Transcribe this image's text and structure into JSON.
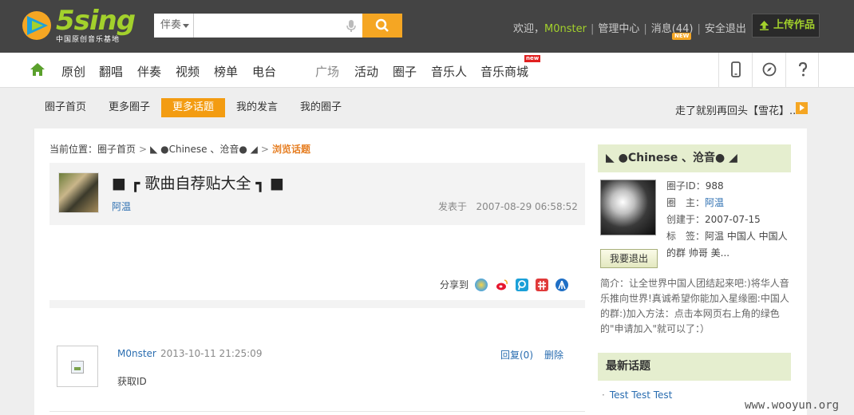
{
  "logo": {
    "text": "5sing",
    "subtitle": "中国原创音乐基地"
  },
  "search": {
    "type_label": "伴奏",
    "placeholder": ""
  },
  "user_bar": {
    "welcome": "欢迎，",
    "username": "M0nster",
    "admin": "管理中心",
    "messages": "消息(44)",
    "messages_badge": "NEW",
    "logout": "安全退出",
    "upload": "上传作品"
  },
  "main_nav": {
    "items": [
      "原创",
      "翻唱",
      "伴奏",
      "视频",
      "榜单",
      "电台",
      "广场",
      "活动",
      "圈子",
      "音乐人",
      "音乐商城"
    ],
    "new_badge": "new"
  },
  "sub_nav": {
    "items": [
      "圈子首页",
      "更多圈子",
      "更多话题",
      "我的发言",
      "我的圈子"
    ],
    "active_index": 2,
    "marquee": "走了就别再回头【雪花】.."
  },
  "breadcrumb": {
    "prefix": "当前位置：",
    "home": "圈子首页",
    "sep": ">",
    "circle": "◣ ●Chinese 、沧音● ◢",
    "current": "浏览话题"
  },
  "topic": {
    "title": "■ ┏ 歌曲自荐贴大全 ┓ ■",
    "author": "阿温",
    "posted_label": "发表于",
    "posted_time": "2007-08-29 06:58:52"
  },
  "share": {
    "label": "分享到"
  },
  "reply": {
    "user": "M0nster",
    "time": "2013-10-11 21:25:09",
    "text": "获取ID",
    "reply_label": "回复(0)",
    "delete_label": "删除"
  },
  "sidebar": {
    "circle_name": "◣ ●Chinese 、沧音● ◢",
    "id_label": "圈子ID：",
    "id_value": "988",
    "owner_label": "圈　主：",
    "owner_value": "阿温",
    "created_label": "创建于：",
    "created_value": "2007-07-15",
    "tags_label": "标　签：",
    "tags_line1": "阿温 中国人 中国人",
    "tags_line2": "的群 帅哥 美...",
    "exit_button": "我要退出",
    "intro": "简介：让全世界中国人团结起来吧:)将华人音乐推向世界!真诚希望你能加入星缘圈:中国人的群:)加入方法：点击本网页右上角的绿色的\"申请加入\"就可以了：）",
    "latest_title": "最新话题",
    "latest_topics": [
      "Test Test Test"
    ]
  },
  "watermark": "www.wooyun.org",
  "colors": {
    "accent": "#f39c12",
    "brand_green": "#a3d12c",
    "link": "#2a6db0",
    "topbar": "#444444"
  }
}
